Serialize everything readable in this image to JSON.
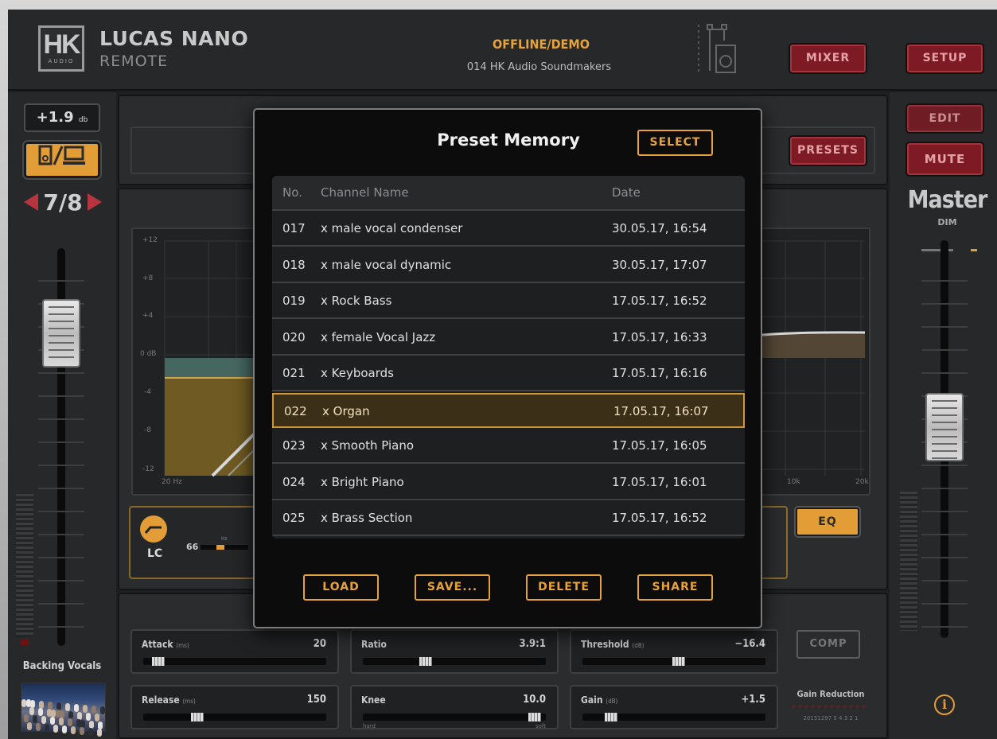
{
  "header": {
    "logo_text": "HK",
    "logo_sub": "AUDIO",
    "app_name": "LUCAS NANO",
    "app_sub": "REMOTE",
    "status": "OFFLINE/DEMO",
    "session": "014 HK Audio Soundmakers",
    "mixer_label": "MIXER",
    "setup_label": "SETUP"
  },
  "left_channel": {
    "gain_value": "+1.9",
    "gain_unit": "db",
    "channel_pair": "7/8",
    "channel_name": "Backing Vocals",
    "fader_level": 0.84
  },
  "right_channel": {
    "edit_label": "EDIT",
    "mute_label": "MUTE",
    "name": "Master",
    "dim_label": "DIM",
    "fader_level": 0.52
  },
  "presets_label": "PRESETS",
  "eq": {
    "button_label": "EQ",
    "y_labels": [
      "+12",
      "+8",
      "+4",
      "0 dB",
      "-4",
      "-8",
      "-12"
    ],
    "x_labels": [
      "20 Hz",
      "10k",
      "20k"
    ],
    "lc_label": "LC",
    "lc_freq": "66",
    "lc_unit": "Hz"
  },
  "compressor": {
    "comp_label": "COMP",
    "gain_reduction_label": "Gain Reduction",
    "gr_scale": "20151297 5 4 3 2 1",
    "params": [
      {
        "label": "Attack",
        "unit": "(ms)",
        "value": "20",
        "level": 0.05
      },
      {
        "label": "Ratio",
        "unit": "",
        "value": "3.9:1",
        "level": 0.33
      },
      {
        "label": "Threshold",
        "unit": "(dB)",
        "value": "−16.4",
        "level": 0.53
      },
      {
        "label": "Release",
        "unit": "(ms)",
        "value": "150",
        "level": 0.28
      },
      {
        "label": "Knee",
        "unit": "",
        "value": "10.0",
        "level": 0.97,
        "min_label": "hard",
        "max_label": "soft"
      },
      {
        "label": "Gain",
        "unit": "(dB)",
        "value": "+1.5",
        "level": 0.13
      }
    ]
  },
  "dialog": {
    "title": "Preset Memory",
    "select_label": "SELECT",
    "columns": [
      "No.",
      "Channel Name",
      "Date"
    ],
    "rows": [
      {
        "no": "017",
        "name": "x male vocal condenser",
        "date": "30.05.17, 16:54"
      },
      {
        "no": "018",
        "name": "x male vocal dynamic",
        "date": "30.05.17, 17:07"
      },
      {
        "no": "019",
        "name": "x Rock Bass",
        "date": "17.05.17, 16:52"
      },
      {
        "no": "020",
        "name": "x female Vocal Jazz",
        "date": "17.05.17, 16:33"
      },
      {
        "no": "021",
        "name": "x Keyboards",
        "date": "17.05.17, 16:16"
      },
      {
        "no": "022",
        "name": "x Organ",
        "date": "17.05.17, 16:07",
        "selected": true
      },
      {
        "no": "023",
        "name": "x Smooth Piano",
        "date": "17.05.17, 16:05"
      },
      {
        "no": "024",
        "name": "x Bright Piano",
        "date": "17.05.17, 16:01"
      },
      {
        "no": "025",
        "name": "x Brass Section",
        "date": "17.05.17, 16:52"
      }
    ],
    "buttons": [
      "LOAD",
      "SAVE...",
      "DELETE",
      "SHARE"
    ]
  },
  "colors": {
    "accent": "#e7a33a",
    "red": "#7e1a24",
    "background": "#1d1f21"
  }
}
